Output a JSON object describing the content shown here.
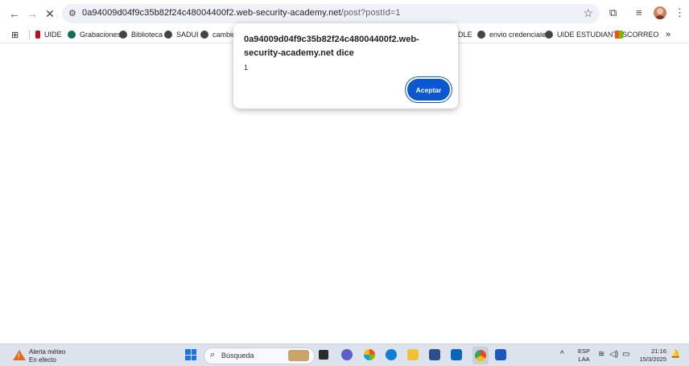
{
  "browser": {
    "url_host": "0a94009d04f9c35b82f24c48004400f2.web-security-academy.net",
    "url_path": "/post?postId=1"
  },
  "bookmarks": [
    {
      "label": "UIDE",
      "color": "#b5121b"
    },
    {
      "label": "Grabaciones",
      "color": "#0f6f55"
    },
    {
      "label": "Biblioteca",
      "color": "#444444"
    },
    {
      "label": "SADUI",
      "color": "#444444"
    },
    {
      "label": "cambio",
      "color": "#444444"
    },
    {
      "label": "DLE",
      "color": ""
    },
    {
      "label": "envio credenciales",
      "color": "#444444"
    },
    {
      "label": "UIDE ESTUDIANTES",
      "color": "#444444"
    },
    {
      "label": "CORREO",
      "color": "#f25022"
    }
  ],
  "dialog": {
    "title": "0a94009d04f9c35b82f24c48004400f2.web-security-academy.net dice",
    "message": "1",
    "ok_label": "Aceptar"
  },
  "taskbar": {
    "weather_title": "Alerta méteo",
    "weather_status": "En efecto",
    "search_placeholder": "Búsqueda",
    "lang_line1": "ESP",
    "lang_line2": "LAA",
    "time": "21:16",
    "date": "15/3/2025"
  },
  "icons": [
    "back-icon",
    "forward-icon",
    "stop-icon",
    "site-settings-icon",
    "star-icon",
    "extensions-icon",
    "media-icon",
    "menu-icon",
    "apps-icon",
    "more-bookmarks-icon"
  ]
}
